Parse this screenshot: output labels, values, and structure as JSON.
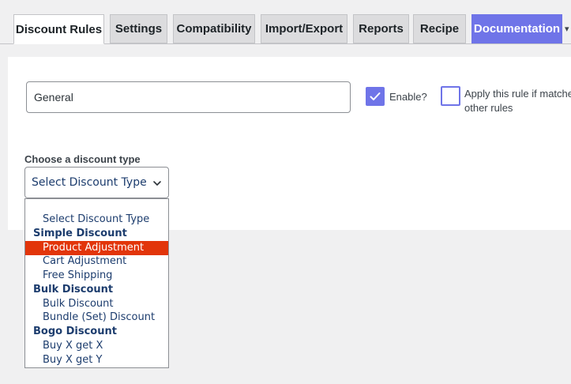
{
  "tabs": [
    {
      "label": "Discount Rules"
    },
    {
      "label": "Settings"
    },
    {
      "label": "Compatibility"
    },
    {
      "label": "Import/Export"
    },
    {
      "label": "Reports"
    },
    {
      "label": "Recipe"
    },
    {
      "label": "Documentation"
    }
  ],
  "form": {
    "rule_name_value": "General",
    "enable_label": "Enable?",
    "enable_checked": true,
    "apply_label": "Apply this rule if matched other rules",
    "apply_checked": false,
    "discount_type_label": "Choose a discount type",
    "discount_type_selected": "Select Discount Type"
  },
  "dropdown": {
    "options": [
      {
        "kind": "item",
        "label": "Select Discount Type"
      },
      {
        "kind": "group",
        "label": "Simple Discount"
      },
      {
        "kind": "item",
        "label": "Product Adjustment",
        "highlighted": true
      },
      {
        "kind": "item",
        "label": "Cart Adjustment"
      },
      {
        "kind": "item",
        "label": "Free Shipping"
      },
      {
        "kind": "group",
        "label": "Bulk Discount"
      },
      {
        "kind": "item",
        "label": "Bulk Discount"
      },
      {
        "kind": "item",
        "label": "Bundle (Set) Discount"
      },
      {
        "kind": "group",
        "label": "Bogo Discount"
      },
      {
        "kind": "item",
        "label": "Buy X get X"
      },
      {
        "kind": "item",
        "label": "Buy X get Y"
      }
    ]
  },
  "colors": {
    "accent": "#6f74e8",
    "highlight": "#e2350a",
    "option_text": "#1d3d6e"
  },
  "icons": {
    "enable_check": "checkmark-icon",
    "select_arrow": "chevron-down-icon",
    "tabs_more": "caret-down-icon"
  }
}
